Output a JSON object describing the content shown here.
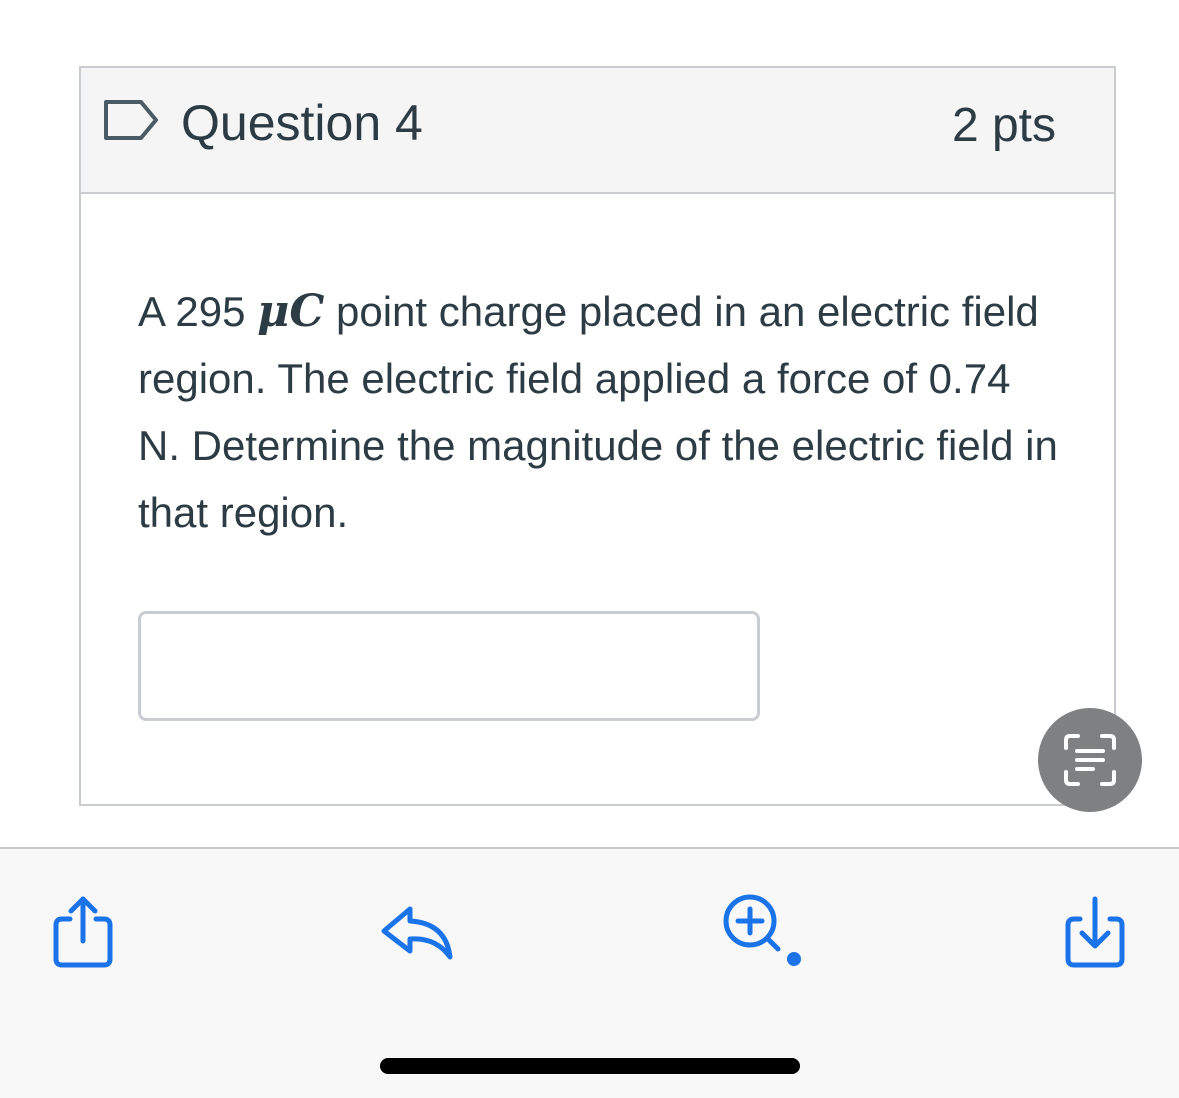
{
  "question": {
    "title": "Question 4",
    "points": "2 pts",
    "text_before": "A 295 ",
    "math": "μC",
    "text_after": " point charge placed in an electric field region. The electric field applied a force of 0.74 N. Determine the magnitude of the electric field in that region.",
    "answer_value": ""
  },
  "toolbar": {
    "items": [
      "share-icon",
      "reply-icon",
      "zoom-in-icon",
      "save-download-icon"
    ]
  },
  "colors": {
    "accent": "#1a73e8",
    "header_bg": "#f5f5f5",
    "border": "#c7cdd1",
    "text": "#2d3b45"
  }
}
